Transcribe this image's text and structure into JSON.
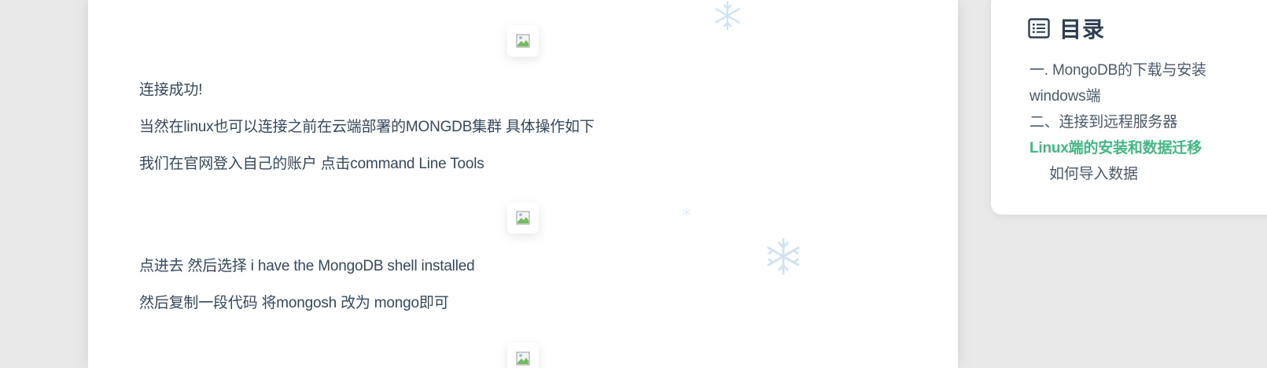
{
  "article": {
    "paragraphs": [
      "连接成功!",
      "当然在linux也可以连接之前在云端部署的MONGDB集群 具体操作如下",
      "我们在官网登入自己的账户 点击command Line Tools",
      "点进去 然后选择 i have the MongoDB shell installed",
      "然后复制一段代码 将mongosh 改为 mongo即可"
    ]
  },
  "toc": {
    "title": "目录",
    "icon": "list-icon",
    "items": [
      {
        "label": "一. MongoDB的下载与安装",
        "active": false
      },
      {
        "label": "windows端",
        "active": false
      },
      {
        "label": "二、连接到远程服务器",
        "active": false
      },
      {
        "label": "Linux端的安装和数据迁移",
        "active": true
      },
      {
        "label": "如何导入数据",
        "active": false
      }
    ]
  },
  "colors": {
    "text": "#34495e",
    "accent": "#42b983",
    "snowflake": "#cfe3f2"
  },
  "decorations": [
    "snowflake-icon",
    "broken-image-icon"
  ]
}
